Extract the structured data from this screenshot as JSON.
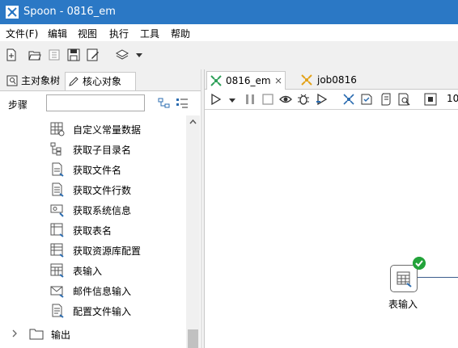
{
  "window": {
    "title": "Spoon - 0816_em"
  },
  "menu": [
    "文件(F)",
    "编辑",
    "视图",
    "执行",
    "工具",
    "帮助"
  ],
  "left_panel": {
    "tabs": [
      {
        "label": "主对象树",
        "active": false
      },
      {
        "label": "核心对象",
        "active": true
      }
    ],
    "search": {
      "label": "步骤",
      "value": ""
    },
    "tree_items": [
      {
        "label": "自定义常量数据",
        "icon": "table-constant-icon"
      },
      {
        "label": "获取子目录名",
        "icon": "folder-tree-icon"
      },
      {
        "label": "获取文件名",
        "icon": "file-name-icon"
      },
      {
        "label": "获取文件行数",
        "icon": "file-rows-icon"
      },
      {
        "label": "获取系统信息",
        "icon": "system-info-icon"
      },
      {
        "label": "获取表名",
        "icon": "table-name-icon"
      },
      {
        "label": "获取资源库配置",
        "icon": "repository-config-icon"
      },
      {
        "label": "表输入",
        "icon": "table-input-icon"
      },
      {
        "label": "邮件信息输入",
        "icon": "mail-input-icon"
      },
      {
        "label": "配置文件输入",
        "icon": "config-file-icon"
      }
    ],
    "category": {
      "label": "输出",
      "icon": "folder-icon",
      "expanded": false
    }
  },
  "editor": {
    "tabs": [
      {
        "label": "0816_em",
        "active": true,
        "closable": true
      },
      {
        "label": "job0816",
        "active": false
      }
    ],
    "toolbar_trailing_text": "10",
    "canvas": {
      "steps": [
        {
          "label": "表输入",
          "status": "ok"
        }
      ]
    }
  },
  "colors": {
    "titlebar": "#2b78c5",
    "ok_badge": "#23a33a",
    "hop": "#3b5d8d"
  }
}
